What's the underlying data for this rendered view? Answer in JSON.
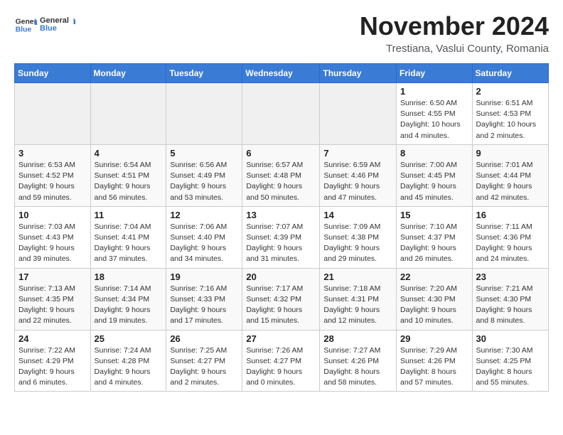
{
  "logo": {
    "text_general": "General",
    "text_blue": "Blue"
  },
  "header": {
    "month": "November 2024",
    "location": "Trestiana, Vaslui County, Romania"
  },
  "weekdays": [
    "Sunday",
    "Monday",
    "Tuesday",
    "Wednesday",
    "Thursday",
    "Friday",
    "Saturday"
  ],
  "weeks": [
    [
      {
        "day": "",
        "sunrise": "",
        "sunset": "",
        "daylight": "",
        "empty": true
      },
      {
        "day": "",
        "sunrise": "",
        "sunset": "",
        "daylight": "",
        "empty": true
      },
      {
        "day": "",
        "sunrise": "",
        "sunset": "",
        "daylight": "",
        "empty": true
      },
      {
        "day": "",
        "sunrise": "",
        "sunset": "",
        "daylight": "",
        "empty": true
      },
      {
        "day": "",
        "sunrise": "",
        "sunset": "",
        "daylight": "",
        "empty": true
      },
      {
        "day": "1",
        "sunrise": "Sunrise: 6:50 AM",
        "sunset": "Sunset: 4:55 PM",
        "daylight": "Daylight: 10 hours and 4 minutes.",
        "empty": false
      },
      {
        "day": "2",
        "sunrise": "Sunrise: 6:51 AM",
        "sunset": "Sunset: 4:53 PM",
        "daylight": "Daylight: 10 hours and 2 minutes.",
        "empty": false
      }
    ],
    [
      {
        "day": "3",
        "sunrise": "Sunrise: 6:53 AM",
        "sunset": "Sunset: 4:52 PM",
        "daylight": "Daylight: 9 hours and 59 minutes.",
        "empty": false
      },
      {
        "day": "4",
        "sunrise": "Sunrise: 6:54 AM",
        "sunset": "Sunset: 4:51 PM",
        "daylight": "Daylight: 9 hours and 56 minutes.",
        "empty": false
      },
      {
        "day": "5",
        "sunrise": "Sunrise: 6:56 AM",
        "sunset": "Sunset: 4:49 PM",
        "daylight": "Daylight: 9 hours and 53 minutes.",
        "empty": false
      },
      {
        "day": "6",
        "sunrise": "Sunrise: 6:57 AM",
        "sunset": "Sunset: 4:48 PM",
        "daylight": "Daylight: 9 hours and 50 minutes.",
        "empty": false
      },
      {
        "day": "7",
        "sunrise": "Sunrise: 6:59 AM",
        "sunset": "Sunset: 4:46 PM",
        "daylight": "Daylight: 9 hours and 47 minutes.",
        "empty": false
      },
      {
        "day": "8",
        "sunrise": "Sunrise: 7:00 AM",
        "sunset": "Sunset: 4:45 PM",
        "daylight": "Daylight: 9 hours and 45 minutes.",
        "empty": false
      },
      {
        "day": "9",
        "sunrise": "Sunrise: 7:01 AM",
        "sunset": "Sunset: 4:44 PM",
        "daylight": "Daylight: 9 hours and 42 minutes.",
        "empty": false
      }
    ],
    [
      {
        "day": "10",
        "sunrise": "Sunrise: 7:03 AM",
        "sunset": "Sunset: 4:43 PM",
        "daylight": "Daylight: 9 hours and 39 minutes.",
        "empty": false
      },
      {
        "day": "11",
        "sunrise": "Sunrise: 7:04 AM",
        "sunset": "Sunset: 4:41 PM",
        "daylight": "Daylight: 9 hours and 37 minutes.",
        "empty": false
      },
      {
        "day": "12",
        "sunrise": "Sunrise: 7:06 AM",
        "sunset": "Sunset: 4:40 PM",
        "daylight": "Daylight: 9 hours and 34 minutes.",
        "empty": false
      },
      {
        "day": "13",
        "sunrise": "Sunrise: 7:07 AM",
        "sunset": "Sunset: 4:39 PM",
        "daylight": "Daylight: 9 hours and 31 minutes.",
        "empty": false
      },
      {
        "day": "14",
        "sunrise": "Sunrise: 7:09 AM",
        "sunset": "Sunset: 4:38 PM",
        "daylight": "Daylight: 9 hours and 29 minutes.",
        "empty": false
      },
      {
        "day": "15",
        "sunrise": "Sunrise: 7:10 AM",
        "sunset": "Sunset: 4:37 PM",
        "daylight": "Daylight: 9 hours and 26 minutes.",
        "empty": false
      },
      {
        "day": "16",
        "sunrise": "Sunrise: 7:11 AM",
        "sunset": "Sunset: 4:36 PM",
        "daylight": "Daylight: 9 hours and 24 minutes.",
        "empty": false
      }
    ],
    [
      {
        "day": "17",
        "sunrise": "Sunrise: 7:13 AM",
        "sunset": "Sunset: 4:35 PM",
        "daylight": "Daylight: 9 hours and 22 minutes.",
        "empty": false
      },
      {
        "day": "18",
        "sunrise": "Sunrise: 7:14 AM",
        "sunset": "Sunset: 4:34 PM",
        "daylight": "Daylight: 9 hours and 19 minutes.",
        "empty": false
      },
      {
        "day": "19",
        "sunrise": "Sunrise: 7:16 AM",
        "sunset": "Sunset: 4:33 PM",
        "daylight": "Daylight: 9 hours and 17 minutes.",
        "empty": false
      },
      {
        "day": "20",
        "sunrise": "Sunrise: 7:17 AM",
        "sunset": "Sunset: 4:32 PM",
        "daylight": "Daylight: 9 hours and 15 minutes.",
        "empty": false
      },
      {
        "day": "21",
        "sunrise": "Sunrise: 7:18 AM",
        "sunset": "Sunset: 4:31 PM",
        "daylight": "Daylight: 9 hours and 12 minutes.",
        "empty": false
      },
      {
        "day": "22",
        "sunrise": "Sunrise: 7:20 AM",
        "sunset": "Sunset: 4:30 PM",
        "daylight": "Daylight: 9 hours and 10 minutes.",
        "empty": false
      },
      {
        "day": "23",
        "sunrise": "Sunrise: 7:21 AM",
        "sunset": "Sunset: 4:30 PM",
        "daylight": "Daylight: 9 hours and 8 minutes.",
        "empty": false
      }
    ],
    [
      {
        "day": "24",
        "sunrise": "Sunrise: 7:22 AM",
        "sunset": "Sunset: 4:29 PM",
        "daylight": "Daylight: 9 hours and 6 minutes.",
        "empty": false
      },
      {
        "day": "25",
        "sunrise": "Sunrise: 7:24 AM",
        "sunset": "Sunset: 4:28 PM",
        "daylight": "Daylight: 9 hours and 4 minutes.",
        "empty": false
      },
      {
        "day": "26",
        "sunrise": "Sunrise: 7:25 AM",
        "sunset": "Sunset: 4:27 PM",
        "daylight": "Daylight: 9 hours and 2 minutes.",
        "empty": false
      },
      {
        "day": "27",
        "sunrise": "Sunrise: 7:26 AM",
        "sunset": "Sunset: 4:27 PM",
        "daylight": "Daylight: 9 hours and 0 minutes.",
        "empty": false
      },
      {
        "day": "28",
        "sunrise": "Sunrise: 7:27 AM",
        "sunset": "Sunset: 4:26 PM",
        "daylight": "Daylight: 8 hours and 58 minutes.",
        "empty": false
      },
      {
        "day": "29",
        "sunrise": "Sunrise: 7:29 AM",
        "sunset": "Sunset: 4:26 PM",
        "daylight": "Daylight: 8 hours and 57 minutes.",
        "empty": false
      },
      {
        "day": "30",
        "sunrise": "Sunrise: 7:30 AM",
        "sunset": "Sunset: 4:25 PM",
        "daylight": "Daylight: 8 hours and 55 minutes.",
        "empty": false
      }
    ]
  ]
}
